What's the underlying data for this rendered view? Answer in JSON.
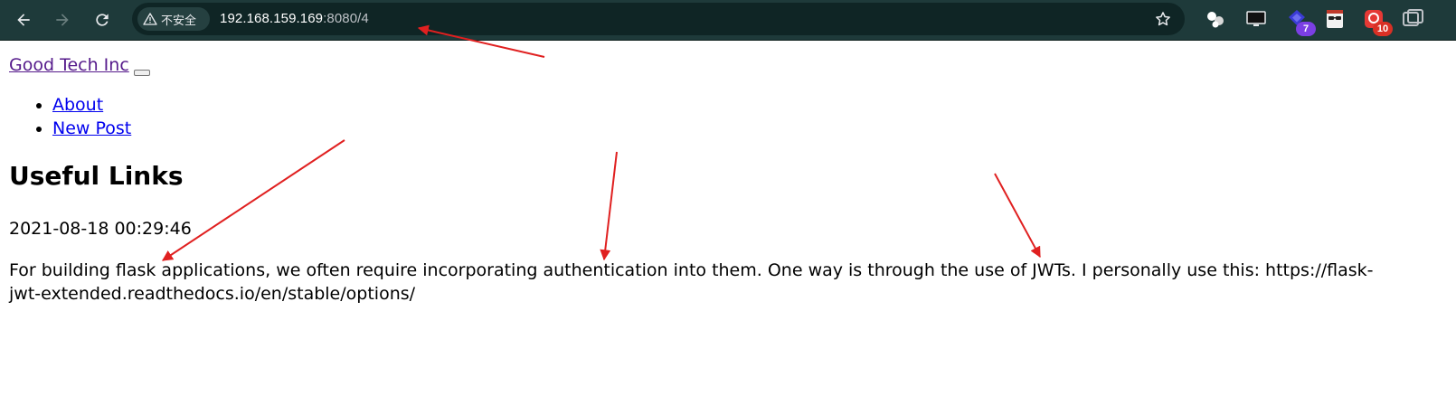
{
  "browser": {
    "security_label": "不安全",
    "url_host": "192.168.159.169",
    "url_rest": ":8080/4",
    "extensions": [
      {
        "icon": "people-icon"
      },
      {
        "icon": "monitor-icon"
      },
      {
        "icon": "purple-extension-icon",
        "badge": "7",
        "badge_color": "#7b3fe4"
      },
      {
        "icon": "glasses-icon"
      },
      {
        "icon": "red-extension-icon",
        "badge": "10",
        "badge_color": "#d93025"
      },
      {
        "icon": "tabs-icon"
      }
    ]
  },
  "site": {
    "brand": "Good Tech Inc",
    "nav": [
      "About",
      "New Post"
    ]
  },
  "post": {
    "title": "Useful Links",
    "date": "2021-08-18 00:29:46",
    "body": "For building flask applications, we often require incorporating authentication into them. One way is through the use of JWTs. I personally use this: https://flask-jwt-extended.readthedocs.io/en/stable/options/"
  },
  "colors": {
    "toolbar_bg": "#1e3a3a",
    "annotation_arrow": "#e02020",
    "link": "#0000ee",
    "visited_link": "#551a8b"
  }
}
